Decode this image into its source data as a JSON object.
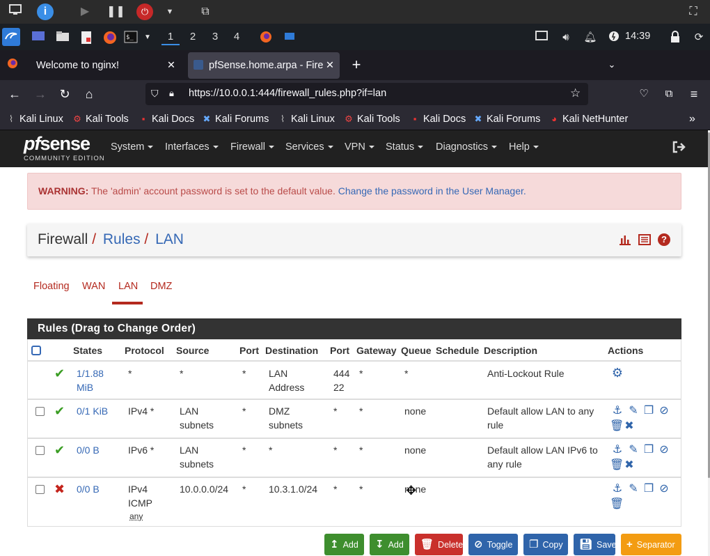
{
  "browser": {
    "tabs": [
      {
        "title": "Welcome to nginx!"
      },
      {
        "title": "pfSense.home.arpa - Fire"
      }
    ],
    "url": "https://10.0.0.1:444/firewall_rules.php?if=lan",
    "bookmarks": [
      "Kali Linux",
      "Kali Tools",
      "Kali Docs",
      "Kali Forums",
      "Kali Linux",
      "Kali Tools",
      "Kali Docs",
      "Kali Forums",
      "Kali NetHunter"
    ]
  },
  "panel": {
    "workspaces": [
      "1",
      "2",
      "3",
      "4"
    ],
    "clock": "14:39"
  },
  "pfsense": {
    "logo_main": "sense",
    "logo_prefix": "pf",
    "logo_sub": "COMMUNITY EDITION",
    "menu": [
      "System",
      "Interfaces",
      "Firewall",
      "Services",
      "VPN",
      "Status",
      "Diagnostics",
      "Help"
    ]
  },
  "warning": {
    "label": "WARNING:",
    "text": " The 'admin' account password is set to the default value. ",
    "link": "Change the password in the User Manager."
  },
  "breadcrumb": {
    "root": "Firewall",
    "sep": "/",
    "mid": "Rules",
    "leaf": "LAN"
  },
  "iftabs": [
    "Floating",
    "WAN",
    "LAN",
    "DMZ"
  ],
  "rules": {
    "title": "Rules (Drag to Change Order)",
    "headers": [
      "States",
      "Protocol",
      "Source",
      "Port",
      "Destination",
      "Port",
      "Gateway",
      "Queue",
      "Schedule",
      "Description",
      "Actions"
    ],
    "rows": [
      {
        "states_1": "1/1.88",
        "states_2": "MiB",
        "protocol_1": "*",
        "protocol_2": "",
        "protocol_3": "",
        "source_1": "*",
        "source_2": "",
        "sport": "*",
        "dest_1": "LAN",
        "dest_2": "Address",
        "dport_1": "444",
        "dport_2": "22",
        "gateway": "*",
        "queue": "*",
        "desc_1": "Anti-Lockout Rule",
        "desc_2": ""
      },
      {
        "states_1": "0/1 KiB",
        "states_2": "",
        "protocol_1": "IPv4 *",
        "protocol_2": "",
        "protocol_3": "",
        "source_1": "LAN",
        "source_2": "subnets",
        "sport": "*",
        "dest_1": "DMZ",
        "dest_2": "subnets",
        "dport_1": "*",
        "dport_2": "",
        "gateway": "*",
        "queue": "none",
        "desc_1": "Default allow LAN to any",
        "desc_2": "rule"
      },
      {
        "states_1": "0/0 B",
        "states_2": "",
        "protocol_1": "IPv6 *",
        "protocol_2": "",
        "protocol_3": "",
        "source_1": "LAN",
        "source_2": "subnets",
        "sport": "*",
        "dest_1": "*",
        "dest_2": "",
        "dport_1": "*",
        "dport_2": "",
        "gateway": "*",
        "queue": "none",
        "desc_1": "Default allow LAN IPv6 to",
        "desc_2": "any rule"
      },
      {
        "states_1": "0/0 B",
        "states_2": "",
        "protocol_1": "IPv4",
        "protocol_2": "ICMP",
        "protocol_3": "any",
        "source_1": "10.0.0.0/24",
        "source_2": "",
        "sport": "*",
        "dest_1": "10.3.1.0/24",
        "dest_2": "",
        "dport_1": "*",
        "dport_2": "",
        "gateway": "*",
        "queue": "none",
        "desc_1": "",
        "desc_2": ""
      }
    ]
  },
  "buttons": {
    "add_top": "Add",
    "add_bottom": "Add",
    "delete": "Delete",
    "toggle": "Toggle",
    "copy": "Copy",
    "save": "Save",
    "separator": "Separator"
  },
  "colors": {
    "add": "#3e8e2e",
    "delete": "#c9302c",
    "toggle": "#2f64aa",
    "copy": "#2f64aa",
    "save": "#2f64aa",
    "separator": "#f39c12"
  }
}
